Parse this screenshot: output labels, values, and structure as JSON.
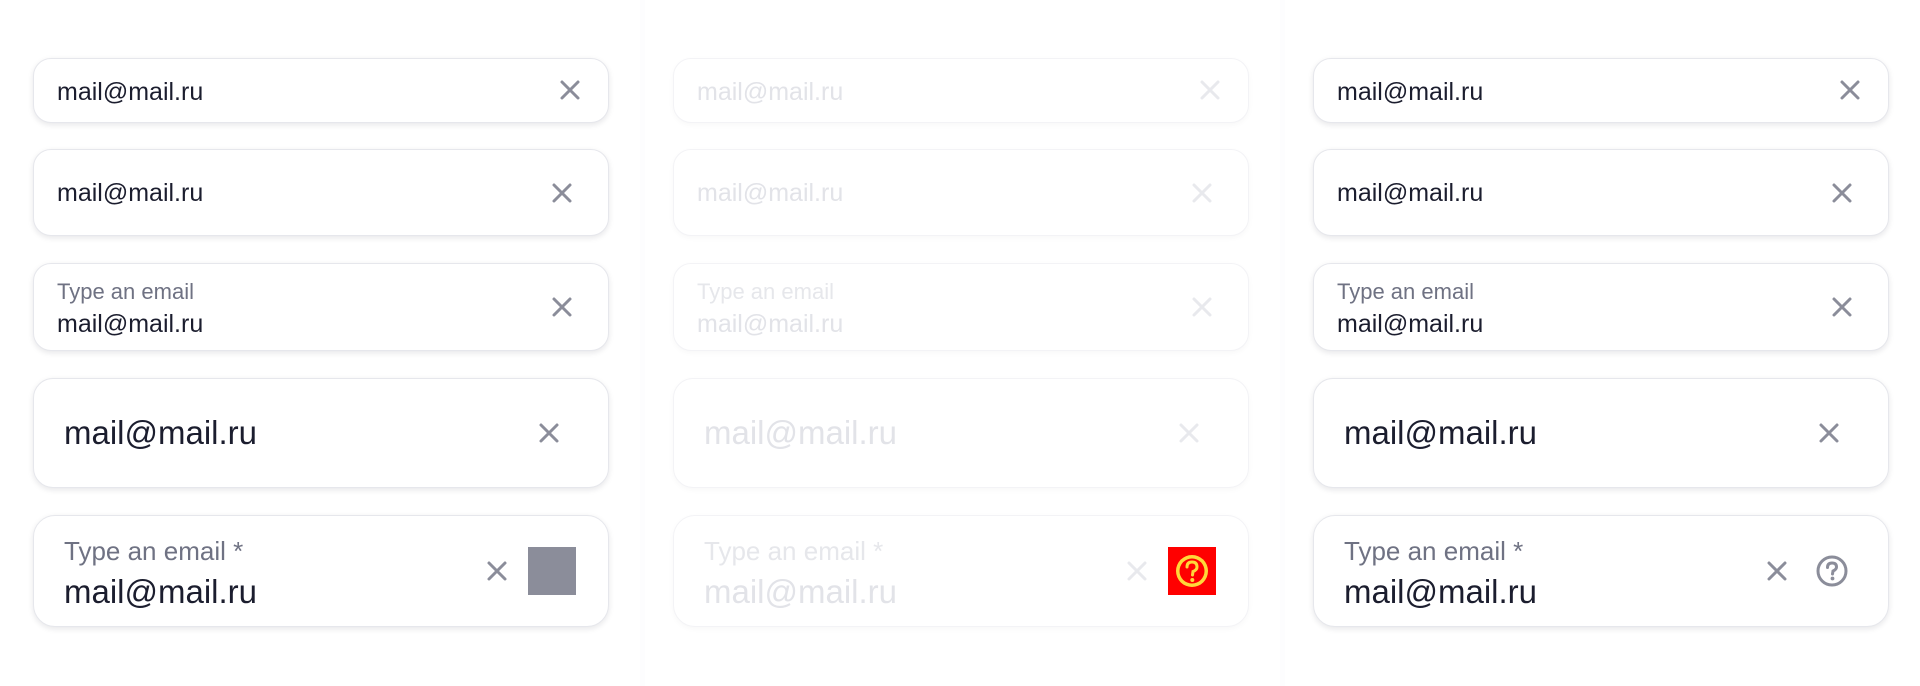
{
  "columns": [
    {
      "state": "default",
      "fields": [
        {
          "value": "mail@mail.ru"
        },
        {
          "value": "mail@mail.ru"
        },
        {
          "label": "Type an email",
          "value": "mail@mail.ru"
        },
        {
          "value": "mail@mail.ru"
        },
        {
          "label": "Type an email *",
          "value": "mail@mail.ru",
          "extra": "gray-square-placeholder"
        }
      ]
    },
    {
      "state": "disabled",
      "fields": [
        {
          "value": "mail@mail.ru"
        },
        {
          "value": "mail@mail.ru"
        },
        {
          "label": "Type an email",
          "value": "mail@mail.ru"
        },
        {
          "value": "mail@mail.ru"
        },
        {
          "label": "Type an email *",
          "value": "mail@mail.ru",
          "extra": "red-help-badge-icon"
        }
      ]
    },
    {
      "state": "default",
      "fields": [
        {
          "value": "mail@mail.ru"
        },
        {
          "value": "mail@mail.ru"
        },
        {
          "label": "Type an email",
          "value": "mail@mail.ru"
        },
        {
          "value": "mail@mail.ru"
        },
        {
          "label": "Type an email *",
          "value": "mail@mail.ru",
          "extra": "question-circle-icon"
        }
      ]
    }
  ],
  "colors": {
    "text": "#1b1d2e",
    "label": "#6f7283",
    "icon": "#8b8d9a",
    "disabled_text": "#e2e3e8",
    "red_badge": "#ff0000",
    "badge_accent": "#ffd83a",
    "placeholder_square": "#8b8d9a"
  }
}
